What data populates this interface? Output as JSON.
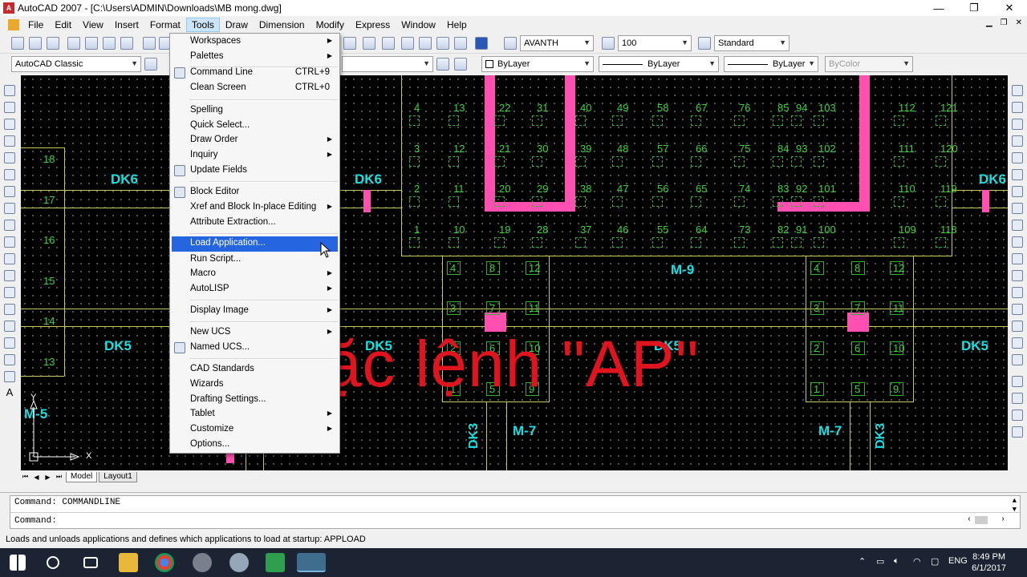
{
  "window": {
    "title": "AutoCAD 2007 - [C:\\Users\\ADMIN\\Downloads\\MB mong.dwg]",
    "app_icon": "A",
    "controls": [
      "—",
      "❐",
      "✕"
    ]
  },
  "menubar": {
    "items": [
      "File",
      "Edit",
      "View",
      "Insert",
      "Format",
      "Tools",
      "Draw",
      "Dimension",
      "Modify",
      "Express",
      "Window",
      "Help"
    ],
    "active": "Tools"
  },
  "toolbar": {
    "text_style": "AVANTH",
    "dim_scale": "100",
    "table_style": "Standard",
    "workspace": "AutoCAD Classic",
    "layer_color": "ByLayer",
    "linetype": "ByLayer",
    "lineweight": "ByLayer",
    "plot_style": "ByColor"
  },
  "tools_menu": {
    "items": [
      {
        "label": "Workspaces",
        "submenu": true
      },
      {
        "label": "Palettes",
        "submenu": true
      },
      {
        "label": "Command Line",
        "shortcut": "CTRL+9",
        "icon": "command-line-icon"
      },
      {
        "label": "Clean Screen",
        "shortcut": "CTRL+0"
      },
      {
        "label": "Spelling"
      },
      {
        "label": "Quick Select..."
      },
      {
        "label": "Draw Order",
        "submenu": true
      },
      {
        "label": "Inquiry",
        "submenu": true
      },
      {
        "label": "Update Fields",
        "icon": "update-fields-icon"
      },
      {
        "label": "Block Editor",
        "icon": "block-editor-icon"
      },
      {
        "label": "Xref and Block In-place Editing",
        "submenu": true
      },
      {
        "label": "Attribute Extraction..."
      },
      {
        "label": "Load Application...",
        "highlighted": true
      },
      {
        "label": "Run Script..."
      },
      {
        "label": "Macro",
        "submenu": true
      },
      {
        "label": "AutoLISP",
        "submenu": true
      },
      {
        "label": "Display Image",
        "submenu": true
      },
      {
        "label": "New UCS",
        "submenu": true
      },
      {
        "label": "Named UCS...",
        "icon": "named-ucs-icon"
      },
      {
        "label": "CAD Standards"
      },
      {
        "label": "Wizards"
      },
      {
        "label": "Drafting Settings..."
      },
      {
        "label": "Tablet",
        "submenu": true
      },
      {
        "label": "Customize",
        "submenu": true
      },
      {
        "label": "Options..."
      }
    ]
  },
  "drawing": {
    "overlay_caption": "Hoặc lệnh \"AP\"",
    "labels": {
      "dk6_left": "DK6",
      "dk6_mid": "DK6",
      "dk6_right": "DK6",
      "dk5_left": "DK5",
      "dk5_mid": "DK5",
      "dk5_center": "DK5",
      "dk5_right": "DK5",
      "m9": "M-9",
      "m5": "M-5",
      "m7_left": "M-7",
      "m7_right": "M-7",
      "dk3_left": "DK3",
      "dk3_right": "DK3"
    },
    "left_col_numbers": [
      "18",
      "17",
      "16",
      "15",
      "14",
      "13"
    ],
    "grid_rows": [
      [
        "4",
        "13",
        "22",
        "31",
        "40",
        "49",
        "58",
        "67",
        "76",
        "85",
        "94",
        "103",
        "112",
        "121"
      ],
      [
        "3",
        "12",
        "21",
        "30",
        "39",
        "48",
        "57",
        "66",
        "75",
        "84",
        "93",
        "102",
        "111",
        "120"
      ],
      [
        "2",
        "11",
        "20",
        "29",
        "38",
        "47",
        "56",
        "65",
        "74",
        "83",
        "92",
        "101",
        "110",
        "119"
      ],
      [
        "1",
        "10",
        "19",
        "28",
        "37",
        "46",
        "55",
        "64",
        "73",
        "82",
        "91",
        "100",
        "109",
        "118"
      ]
    ],
    "pile_group_left": [
      [
        "4",
        "8",
        "12"
      ],
      [
        "3",
        "7",
        "11"
      ],
      [
        "2",
        "6",
        "10"
      ],
      [
        "1",
        "5",
        "9"
      ]
    ],
    "pile_group_right": [
      [
        "4",
        "8",
        "12"
      ],
      [
        "3",
        "7",
        "11"
      ],
      [
        "2",
        "6",
        "10"
      ],
      [
        "1",
        "5",
        "9"
      ]
    ],
    "ucs_y": "Y",
    "ucs_x": "X"
  },
  "tabs": {
    "model": "Model",
    "layout": "Layout1",
    "nav": [
      "⏮",
      "◀",
      "▶",
      "⏭"
    ]
  },
  "command": {
    "line1": "Command: COMMANDLINE",
    "line2": "Command:"
  },
  "status": {
    "text": "Loads and unloads applications and defines which applications to load at startup:  APPLOAD"
  },
  "taskbar": {
    "language": "ENG",
    "time": "8:49 PM",
    "date": "6/1/2017"
  },
  "colors": {
    "canvas": "#000000",
    "pink": "#ff4fb0",
    "cyan": "#19e0e0",
    "green": "#3bd43b",
    "caption_red": "#e0141e",
    "menu_highlight": "#2565e0"
  }
}
